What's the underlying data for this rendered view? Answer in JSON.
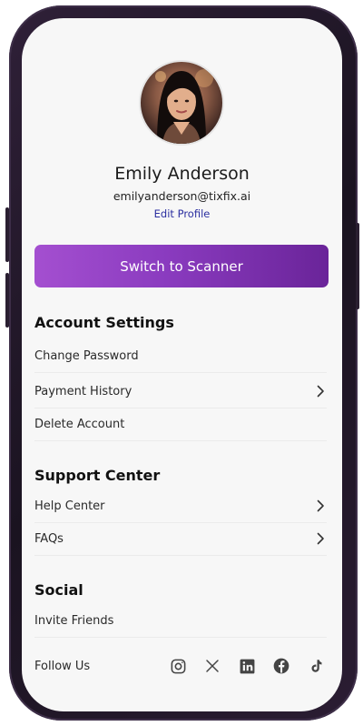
{
  "profile": {
    "name": "Emily Anderson",
    "email": "emilyanderson@tixfix.ai",
    "edit_label": "Edit Profile",
    "avatar_icon": "user-photo"
  },
  "primary_action": {
    "label": "Switch to Scanner",
    "gradient_start": "#a44fd0",
    "gradient_end": "#6a2499"
  },
  "account_settings": {
    "title": "Account Settings",
    "items": [
      {
        "label": "Change Password",
        "chevron": false
      },
      {
        "label": "Payment History",
        "chevron": true
      },
      {
        "label": "Delete Account",
        "chevron": false
      }
    ]
  },
  "support_center": {
    "title": "Support Center",
    "items": [
      {
        "label": "Help Center",
        "chevron": true
      },
      {
        "label": "FAQs",
        "chevron": true
      }
    ]
  },
  "social": {
    "title": "Social",
    "invite_label": "Invite Friends",
    "follow_label": "Follow Us",
    "icons": [
      "instagram-icon",
      "x-icon",
      "linkedin-icon",
      "facebook-icon",
      "tiktok-icon"
    ]
  }
}
